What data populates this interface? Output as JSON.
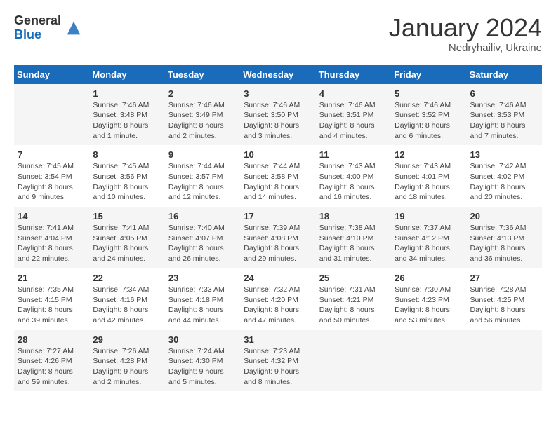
{
  "logo": {
    "general": "General",
    "blue": "Blue"
  },
  "title": "January 2024",
  "location": "Nedryhailiv, Ukraine",
  "days_of_week": [
    "Sunday",
    "Monday",
    "Tuesday",
    "Wednesday",
    "Thursday",
    "Friday",
    "Saturday"
  ],
  "weeks": [
    [
      {
        "day": null,
        "info": null
      },
      {
        "day": "1",
        "sunrise": "7:46 AM",
        "sunset": "3:48 PM",
        "daylight": "8 hours and 1 minute."
      },
      {
        "day": "2",
        "sunrise": "7:46 AM",
        "sunset": "3:49 PM",
        "daylight": "8 hours and 2 minutes."
      },
      {
        "day": "3",
        "sunrise": "7:46 AM",
        "sunset": "3:50 PM",
        "daylight": "8 hours and 3 minutes."
      },
      {
        "day": "4",
        "sunrise": "7:46 AM",
        "sunset": "3:51 PM",
        "daylight": "8 hours and 4 minutes."
      },
      {
        "day": "5",
        "sunrise": "7:46 AM",
        "sunset": "3:52 PM",
        "daylight": "8 hours and 6 minutes."
      },
      {
        "day": "6",
        "sunrise": "7:46 AM",
        "sunset": "3:53 PM",
        "daylight": "8 hours and 7 minutes."
      }
    ],
    [
      {
        "day": "7",
        "sunrise": "7:45 AM",
        "sunset": "3:54 PM",
        "daylight": "8 hours and 9 minutes."
      },
      {
        "day": "8",
        "sunrise": "7:45 AM",
        "sunset": "3:56 PM",
        "daylight": "8 hours and 10 minutes."
      },
      {
        "day": "9",
        "sunrise": "7:44 AM",
        "sunset": "3:57 PM",
        "daylight": "8 hours and 12 minutes."
      },
      {
        "day": "10",
        "sunrise": "7:44 AM",
        "sunset": "3:58 PM",
        "daylight": "8 hours and 14 minutes."
      },
      {
        "day": "11",
        "sunrise": "7:43 AM",
        "sunset": "4:00 PM",
        "daylight": "8 hours and 16 minutes."
      },
      {
        "day": "12",
        "sunrise": "7:43 AM",
        "sunset": "4:01 PM",
        "daylight": "8 hours and 18 minutes."
      },
      {
        "day": "13",
        "sunrise": "7:42 AM",
        "sunset": "4:02 PM",
        "daylight": "8 hours and 20 minutes."
      }
    ],
    [
      {
        "day": "14",
        "sunrise": "7:41 AM",
        "sunset": "4:04 PM",
        "daylight": "8 hours and 22 minutes."
      },
      {
        "day": "15",
        "sunrise": "7:41 AM",
        "sunset": "4:05 PM",
        "daylight": "8 hours and 24 minutes."
      },
      {
        "day": "16",
        "sunrise": "7:40 AM",
        "sunset": "4:07 PM",
        "daylight": "8 hours and 26 minutes."
      },
      {
        "day": "17",
        "sunrise": "7:39 AM",
        "sunset": "4:08 PM",
        "daylight": "8 hours and 29 minutes."
      },
      {
        "day": "18",
        "sunrise": "7:38 AM",
        "sunset": "4:10 PM",
        "daylight": "8 hours and 31 minutes."
      },
      {
        "day": "19",
        "sunrise": "7:37 AM",
        "sunset": "4:12 PM",
        "daylight": "8 hours and 34 minutes."
      },
      {
        "day": "20",
        "sunrise": "7:36 AM",
        "sunset": "4:13 PM",
        "daylight": "8 hours and 36 minutes."
      }
    ],
    [
      {
        "day": "21",
        "sunrise": "7:35 AM",
        "sunset": "4:15 PM",
        "daylight": "8 hours and 39 minutes."
      },
      {
        "day": "22",
        "sunrise": "7:34 AM",
        "sunset": "4:16 PM",
        "daylight": "8 hours and 42 minutes."
      },
      {
        "day": "23",
        "sunrise": "7:33 AM",
        "sunset": "4:18 PM",
        "daylight": "8 hours and 44 minutes."
      },
      {
        "day": "24",
        "sunrise": "7:32 AM",
        "sunset": "4:20 PM",
        "daylight": "8 hours and 47 minutes."
      },
      {
        "day": "25",
        "sunrise": "7:31 AM",
        "sunset": "4:21 PM",
        "daylight": "8 hours and 50 minutes."
      },
      {
        "day": "26",
        "sunrise": "7:30 AM",
        "sunset": "4:23 PM",
        "daylight": "8 hours and 53 minutes."
      },
      {
        "day": "27",
        "sunrise": "7:28 AM",
        "sunset": "4:25 PM",
        "daylight": "8 hours and 56 minutes."
      }
    ],
    [
      {
        "day": "28",
        "sunrise": "7:27 AM",
        "sunset": "4:26 PM",
        "daylight": "8 hours and 59 minutes."
      },
      {
        "day": "29",
        "sunrise": "7:26 AM",
        "sunset": "4:28 PM",
        "daylight": "9 hours and 2 minutes."
      },
      {
        "day": "30",
        "sunrise": "7:24 AM",
        "sunset": "4:30 PM",
        "daylight": "9 hours and 5 minutes."
      },
      {
        "day": "31",
        "sunrise": "7:23 AM",
        "sunset": "4:32 PM",
        "daylight": "9 hours and 8 minutes."
      },
      {
        "day": null,
        "info": null
      },
      {
        "day": null,
        "info": null
      },
      {
        "day": null,
        "info": null
      }
    ]
  ]
}
